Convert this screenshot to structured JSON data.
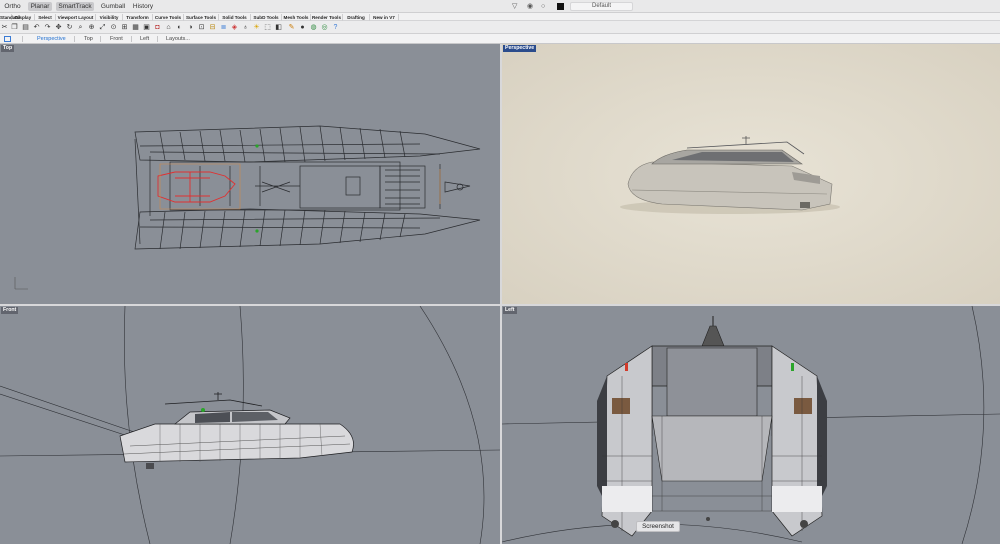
{
  "topbar": {
    "snap_buttons": [
      {
        "label": "Ortho",
        "on": false
      },
      {
        "label": "Planar",
        "on": true
      },
      {
        "label": "SmartTrack",
        "on": true
      },
      {
        "label": "Gumball",
        "on": false
      },
      {
        "label": "History",
        "on": false
      }
    ],
    "layer_name": "Default",
    "layer_color": "#111111",
    "icons": [
      "filter-icon",
      "eye-icon",
      "circle-icon"
    ]
  },
  "tabs": [
    {
      "label": "Standard",
      "active": false
    },
    {
      "label": "Display",
      "active": false
    },
    {
      "label": "Select",
      "active": false
    },
    {
      "label": "Viewport Layout",
      "active": false
    },
    {
      "label": "Visibility",
      "active": false
    },
    {
      "label": "Transform",
      "active": false
    },
    {
      "label": "Curve Tools",
      "active": false
    },
    {
      "label": "Surface Tools",
      "active": false
    },
    {
      "label": "Solid Tools",
      "active": false
    },
    {
      "label": "SubD Tools",
      "active": false
    },
    {
      "label": "Mesh Tools",
      "active": false
    },
    {
      "label": "Render Tools",
      "active": false
    },
    {
      "label": "Drafting",
      "active": false
    },
    {
      "label": "New in V7",
      "active": false
    }
  ],
  "toolbar_icons": [
    "cut-icon",
    "copy-icon",
    "paste-icon",
    "undo-icon",
    "redo-icon",
    "pan-icon",
    "rotate-view-icon",
    "zoom-icon",
    "zoom-window-icon",
    "zoom-extents-icon",
    "zoom-selected-icon",
    "four-viewports-icon",
    "grid-icon",
    "named-views-icon",
    "camera-icon",
    "trash-icon",
    "hide-icon",
    "show-icon",
    "lock-icon",
    "unlock-icon",
    "layer-icon",
    "properties-icon",
    "bulb-icon",
    "light-icon",
    "select-icon",
    "render-icon",
    "material-icon",
    "shaded-sphere-icon",
    "world-icon",
    "options-icon",
    "help-icon"
  ],
  "viewport_tabs": [
    {
      "label": "Perspective",
      "active": true
    },
    {
      "label": "Top",
      "active": false
    },
    {
      "label": "Front",
      "active": false
    },
    {
      "label": "Left",
      "active": false
    },
    {
      "label": "Layouts...",
      "active": false
    }
  ],
  "viewports": {
    "top": {
      "title": "Top",
      "active": false
    },
    "perspective": {
      "title": "Perspective",
      "active": true
    },
    "front": {
      "title": "Front",
      "active": false
    },
    "left": {
      "title": "Left",
      "active": false
    }
  },
  "tooltip": "Screenshot",
  "colors": {
    "viewport_bg": "#8a8f97",
    "perspective_bg": "#e2dccd",
    "active_title": "#2b4c8c",
    "accent": "#1f6fd1"
  }
}
